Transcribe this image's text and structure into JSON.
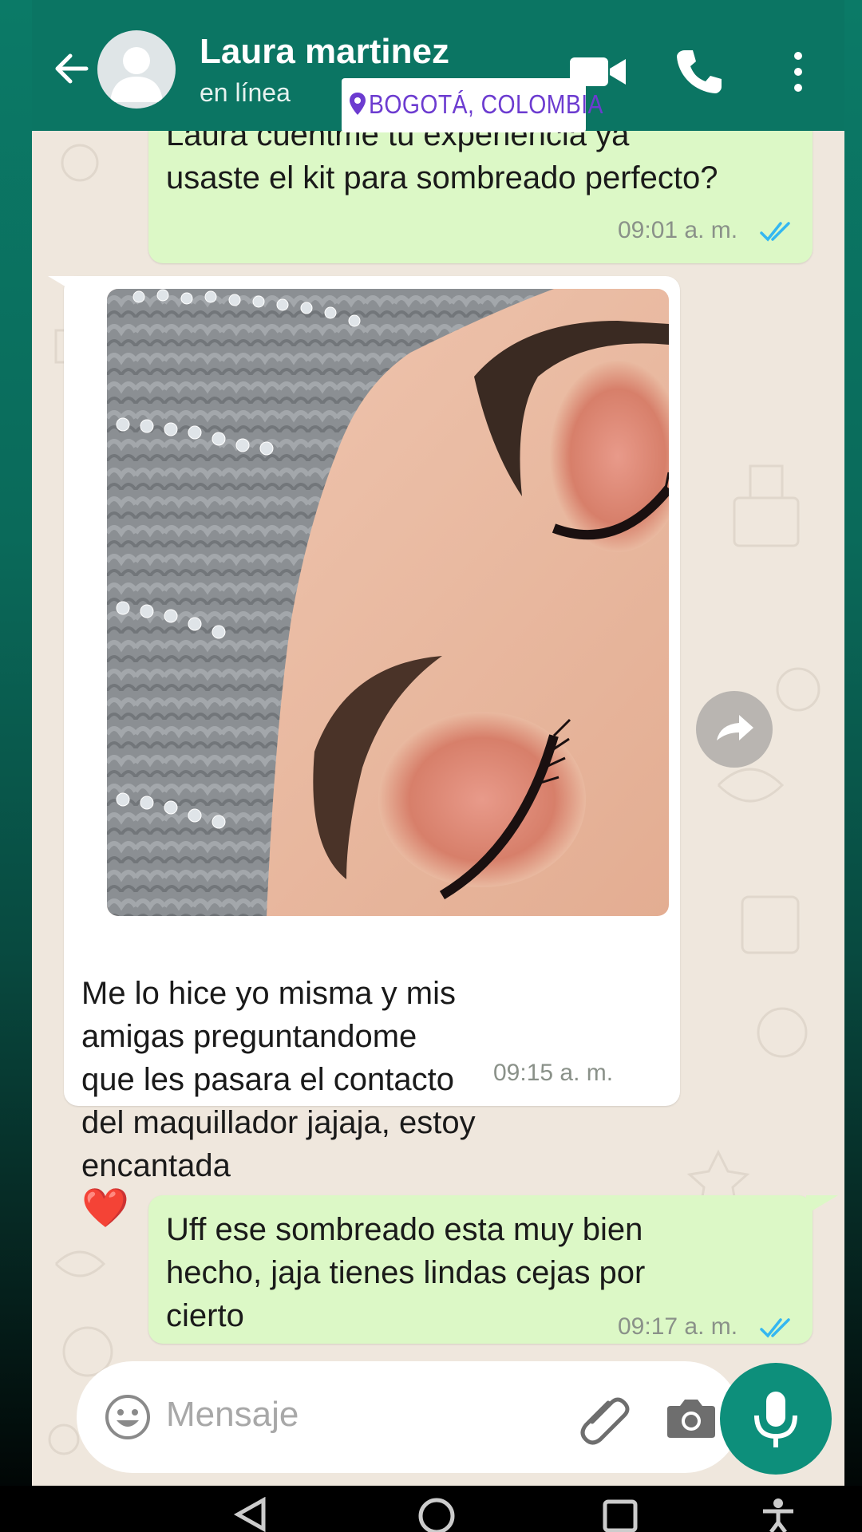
{
  "header": {
    "contact_name": "Laura martinez",
    "status": "en línea",
    "location_sticker": "BOGOTÁ, COLOMBIA",
    "icons": [
      "back-arrow-icon",
      "avatar-placeholder-icon",
      "video-call-icon",
      "phone-icon",
      "more-vert-icon"
    ]
  },
  "messages": [
    {
      "direction": "out",
      "text": "Laura cuentme tu experiencia ya\nusaste el kit para sombreado perfecto?",
      "time": "09:01 a. m.",
      "ticks": "read"
    },
    {
      "direction": "in",
      "type": "image",
      "caption": "Me lo hice yo misma y mis\namigas preguntandome\nque les pasara el contacto\ndel maquillador jajaja, estoy\nencantada",
      "emoji": "❤️",
      "time": "09:15 a. m."
    },
    {
      "direction": "out",
      "text": "Uff ese sombreado esta muy bien\nhecho, jaja tienes lindas cejas por\ncierto",
      "time": "09:17 a. m.",
      "ticks": "read"
    }
  ],
  "input": {
    "placeholder": "Mensaje"
  },
  "colors": {
    "header": "#0b7563",
    "outgoing": "#dcf8c6",
    "incoming": "#ffffff",
    "ticks_read": "#34b7f1",
    "mic_button": "#0d8f7b",
    "sticker_text": "#6c3bd0"
  }
}
